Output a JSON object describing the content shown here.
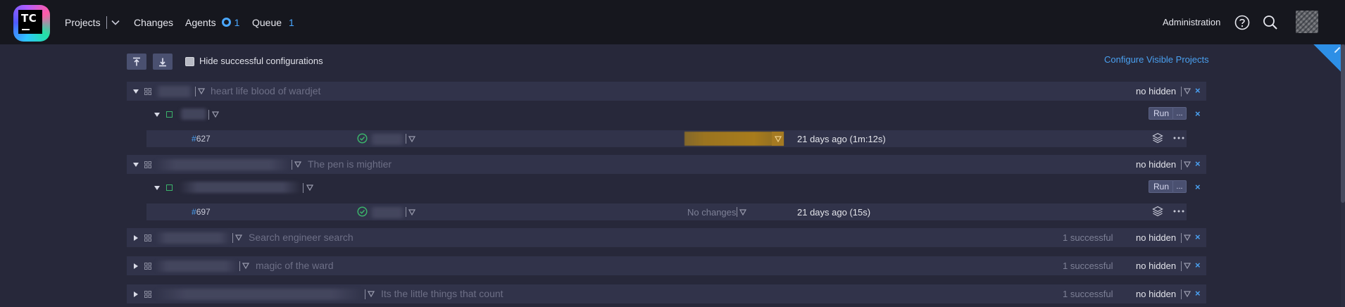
{
  "header": {
    "logo_text": "TC",
    "projects_label": "Projects",
    "changes_label": "Changes",
    "agents_label": "Agents",
    "agents_count": "1",
    "queue_label": "Queue",
    "queue_count": "1",
    "admin_label": "Administration"
  },
  "toolbar": {
    "hide_label": "Hide successful configurations",
    "configure_link": "Configure Visible Projects"
  },
  "rows": {
    "p1_desc": "heart life blood of wardjet",
    "p1_hidden": "no hidden",
    "run_label": "Run",
    "more_label": "...",
    "b1_hash": "#",
    "b1_num": "627",
    "b1_time": "21 days ago (1m:12s)",
    "p2_desc": "The pen is mightier",
    "p2_hidden": "no hidden",
    "b2_hash": "#",
    "b2_num": "697",
    "b2_changes": "No changes",
    "b2_time": "21 days ago (15s)",
    "p3_desc": "Search engineer search",
    "p3_status": "1 successful",
    "p3_hidden": "no hidden",
    "p4_desc": "magic of the ward",
    "p4_status": "1 successful",
    "p4_hidden": "no hidden",
    "p5_desc": "Its the little things that count",
    "p5_status": "1 successful",
    "p5_hidden": "no hidden",
    "close_glyph": "×"
  },
  "colors": {
    "accent": "#4aa0f0",
    "success": "#3bb36b",
    "header_bg": "#16171e",
    "page_bg": "#27283a"
  },
  "icons": [
    "teamcity-logo",
    "chevron-down-icon",
    "agent-ring-icon",
    "help-icon",
    "search-icon",
    "collapse-all-icon",
    "expand-all-icon",
    "triangle-icon",
    "grid-icon",
    "check-circle-icon",
    "layers-icon",
    "more-icon"
  ]
}
